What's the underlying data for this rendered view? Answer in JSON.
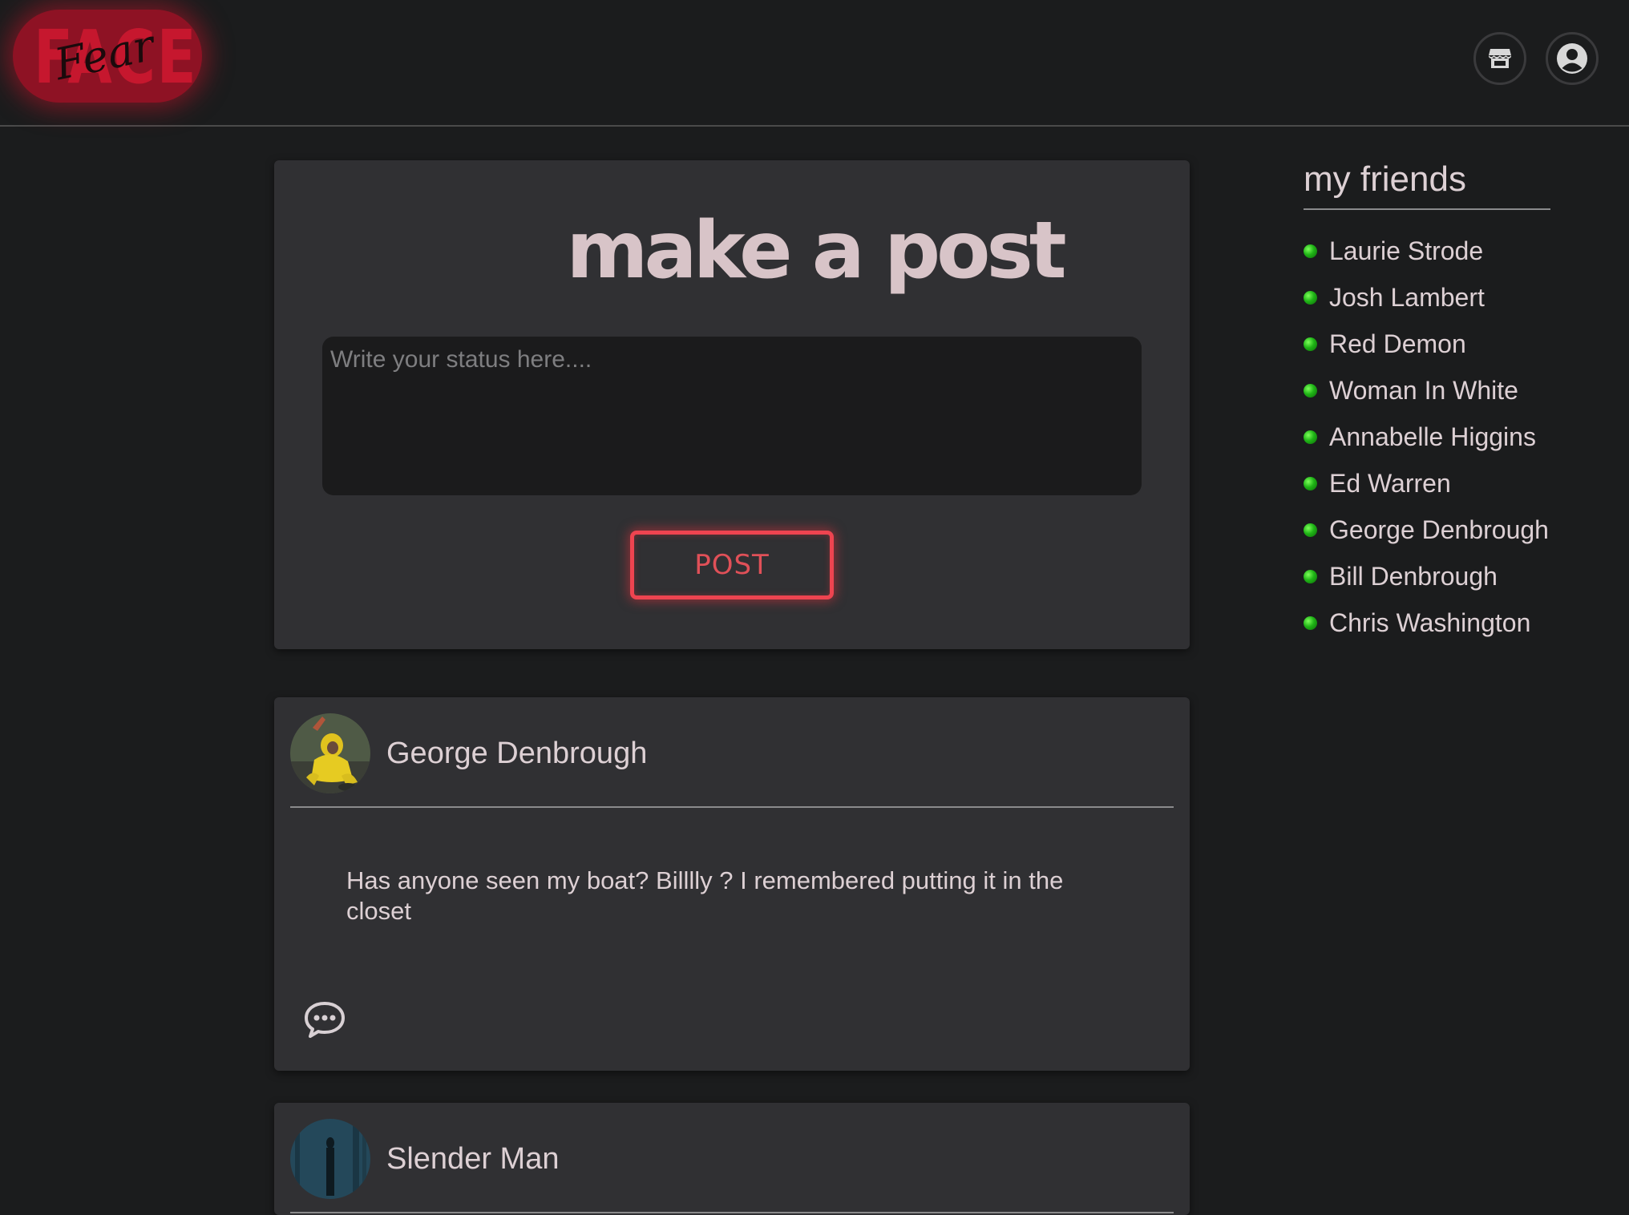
{
  "logo": {
    "big_text": "FACE",
    "script_text": "Fear"
  },
  "header": {
    "icons": [
      "store-icon",
      "account-circle-icon"
    ]
  },
  "post_form": {
    "title": "make a post",
    "placeholder": "Write your status here....",
    "button_label": "POST"
  },
  "posts": [
    {
      "author": "George Denbrough",
      "text": "Has anyone seen my boat? Billlly ? I remembered putting it in the closet",
      "comment_icon": "comment-bubble-icon"
    },
    {
      "author": "Slender Man"
    }
  ],
  "friends": {
    "title": "my friends",
    "items": [
      {
        "name": "Laurie Strode"
      },
      {
        "name": "Josh Lambert"
      },
      {
        "name": "Red Demon"
      },
      {
        "name": "Woman In White"
      },
      {
        "name": "Annabelle Higgins"
      },
      {
        "name": "Ed Warren"
      },
      {
        "name": "George Denbrough"
      },
      {
        "name": "Bill Denbrough"
      },
      {
        "name": "Chris Washington"
      }
    ],
    "status_color": "#1fb416"
  },
  "colors": {
    "background": "#1b1c1d",
    "card": "#303033",
    "accent_red": "#ee4450",
    "text": "#ddd0d4"
  }
}
